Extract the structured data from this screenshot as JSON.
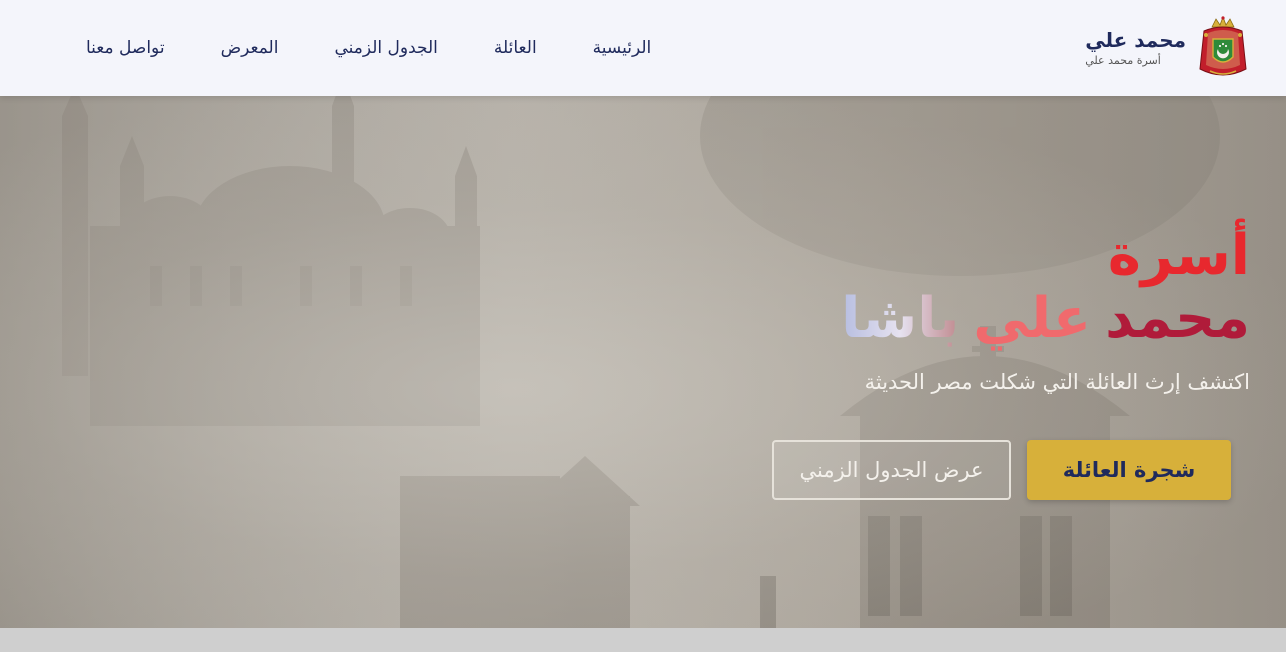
{
  "brand": {
    "title": "محمد علي",
    "subtitle": "أسرة محمد علي",
    "emblem_icon": "royal-crest-icon"
  },
  "nav": {
    "items": [
      {
        "label": "الرئيسية"
      },
      {
        "label": "العائلة"
      },
      {
        "label": "الجدول الزمني"
      },
      {
        "label": "المعرض"
      },
      {
        "label": "تواصل معنا"
      }
    ]
  },
  "hero": {
    "title_line1": "أسرة",
    "title_word_mohamed": "محمد",
    "title_word_ali": "علي",
    "title_word_pasha": "باشا",
    "subtitle": "اكتشف إرث العائلة التي شكلت مصر الحديثة",
    "primary_button": "شجرة العائلة",
    "secondary_button": "عرض الجدول الزمني"
  },
  "colors": {
    "navy": "#1f2a5c",
    "gold": "#d7b03a",
    "red": "#e8282e",
    "crimson": "#b01b3a"
  }
}
